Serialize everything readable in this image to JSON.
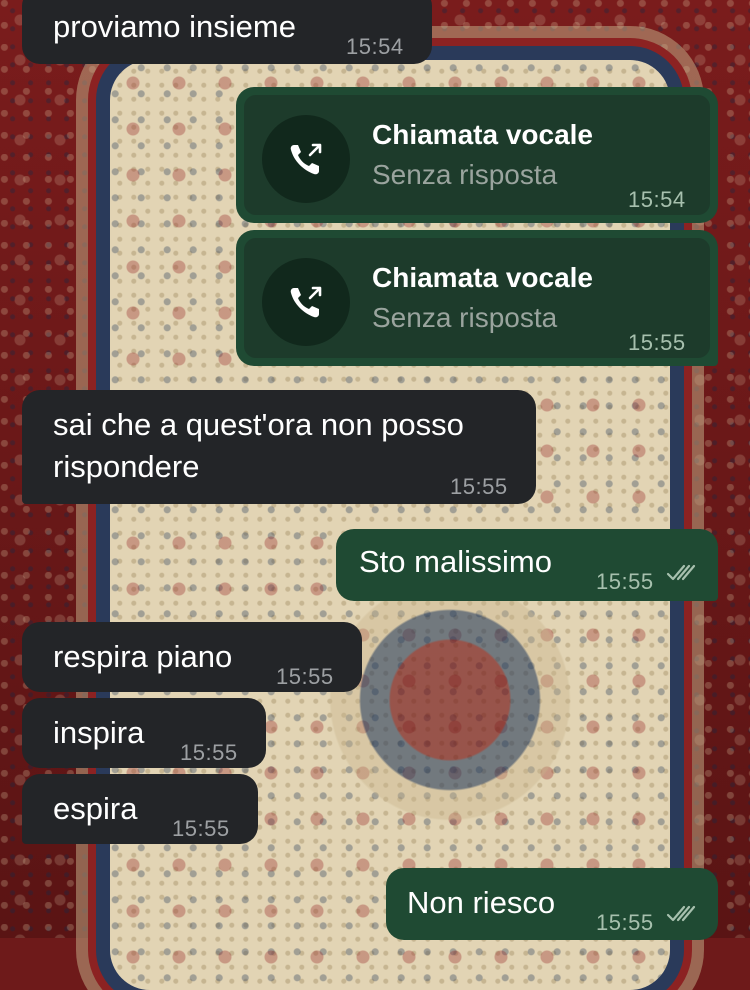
{
  "messages": [
    {
      "text": "proviamo insieme",
      "time": "15:54",
      "direction": "incoming"
    },
    {
      "type": "call",
      "title": "Chiamata vocale",
      "status": "Senza risposta",
      "time": "15:54",
      "direction": "outgoing",
      "icon": "outgoing-call-icon"
    },
    {
      "type": "call",
      "title": "Chiamata vocale",
      "status": "Senza risposta",
      "time": "15:55",
      "direction": "outgoing",
      "icon": "outgoing-call-icon"
    },
    {
      "text_line1": "sai che a quest'ora non posso",
      "text_line2": "rispondere",
      "time": "15:55",
      "direction": "incoming"
    },
    {
      "text": "Sto malissimo",
      "time": "15:55",
      "direction": "outgoing",
      "status_icon": "double-check-icon"
    },
    {
      "text": "respira piano",
      "time": "15:55",
      "direction": "incoming"
    },
    {
      "text": "inspira",
      "time": "15:55",
      "direction": "incoming"
    },
    {
      "text": "espira",
      "time": "15:55",
      "direction": "incoming"
    },
    {
      "text": "Non riesco",
      "time": "15:55",
      "direction": "outgoing",
      "status_icon": "double-check-icon"
    }
  ],
  "colors": {
    "incoming_bubble": "#232528",
    "outgoing_bubble": "#1f4a33",
    "call_card": "#1d3b2b",
    "timestamp": "#9da0a3"
  }
}
